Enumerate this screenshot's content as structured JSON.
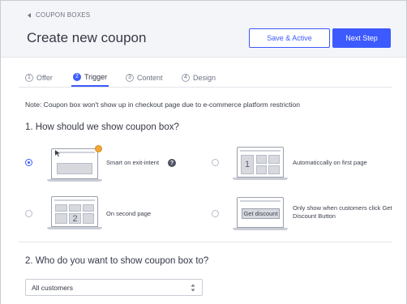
{
  "header": {
    "back_label": "COUPON BOXES",
    "title": "Create new coupon",
    "save_active_label": "Save & Active",
    "next_step_label": "Next Step"
  },
  "tabs": [
    {
      "num": "1",
      "label": "Offer",
      "active": false
    },
    {
      "num": "2",
      "label": "Trigger",
      "active": true
    },
    {
      "num": "3",
      "label": "Content",
      "active": false
    },
    {
      "num": "4",
      "label": "Design",
      "active": false
    }
  ],
  "note": "Note: Coupon box won't show up in checkout page due to e-commerce platform restriction",
  "section1": {
    "title": "1. How should we show coupon box?",
    "options": [
      {
        "label": "Smart on exit-intent",
        "checked": true,
        "help": "?"
      },
      {
        "label": "Automaticcally on first page",
        "checked": false,
        "screen_number": "1"
      },
      {
        "label": "On second page",
        "checked": false,
        "screen_number": "2"
      },
      {
        "label": "Only show when customers click Get Discount Button",
        "checked": false,
        "screen_button": "Get discount"
      }
    ]
  },
  "section2": {
    "title": "2. Who do you want to show coupon box to?",
    "select_value": "All customers"
  },
  "colors": {
    "accent": "#3d5afe",
    "header_bg": "#f4f5f8",
    "badge": "#f0a73a"
  },
  "icons": {
    "back": "triangle-left-icon",
    "help": "question-circle-icon",
    "badge": "award-badge-icon",
    "cursor": "mouse-cursor-icon",
    "select": "up-down-arrows-icon"
  }
}
